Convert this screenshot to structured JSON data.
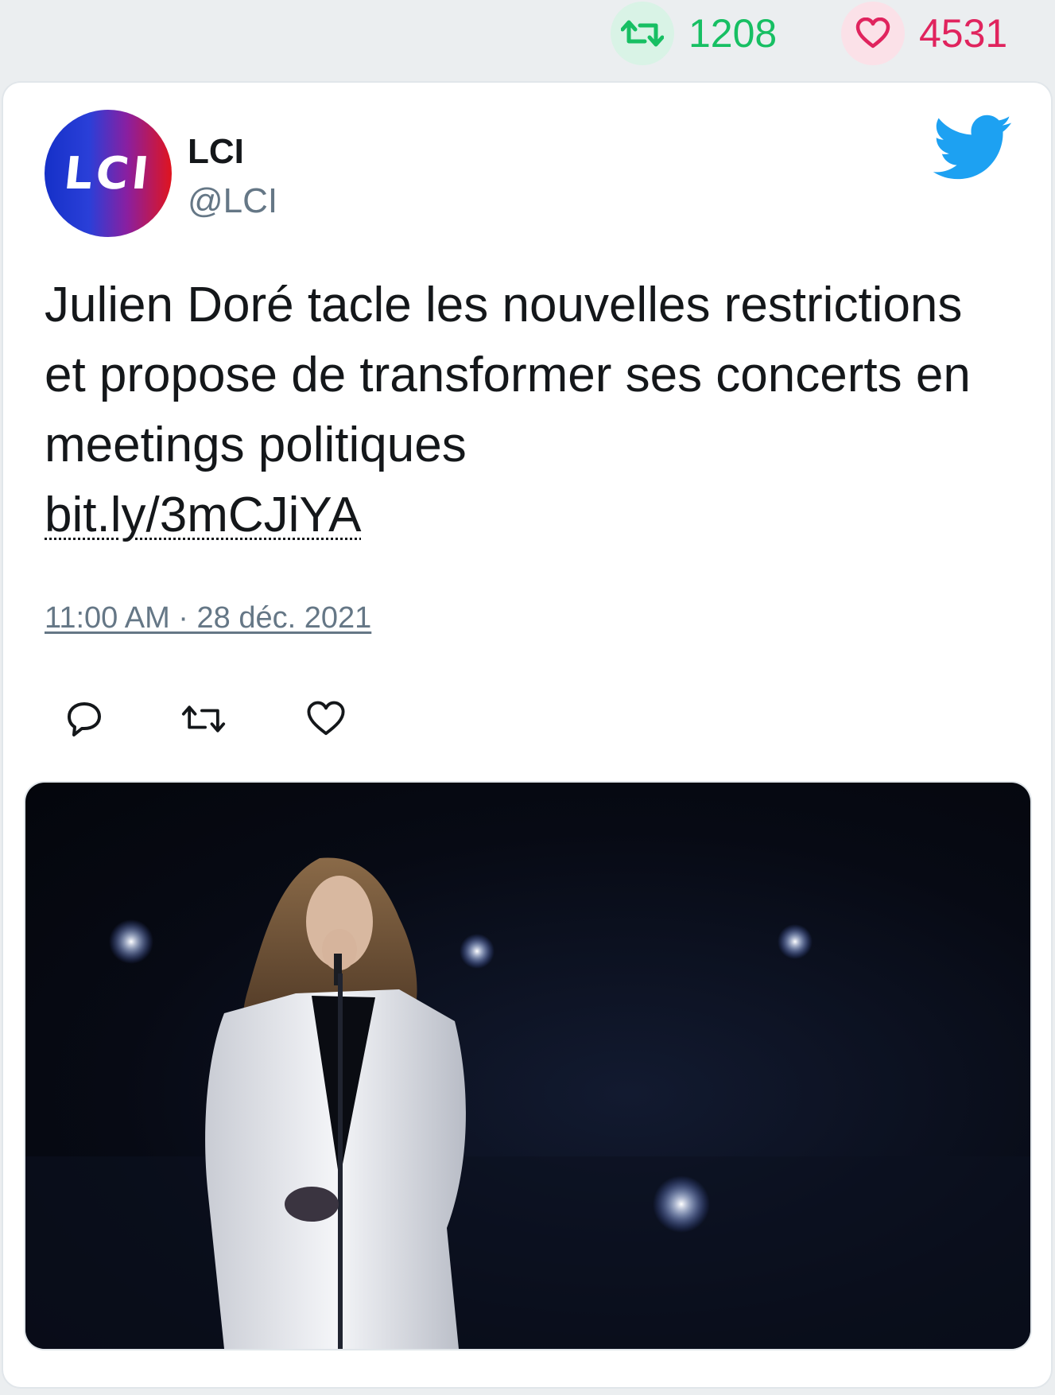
{
  "stats": {
    "retweets": "1208",
    "likes": "4531"
  },
  "author": {
    "name": "LCI",
    "handle": "@LCI",
    "avatar_text": "LCI"
  },
  "tweet": {
    "text": "Julien Doré tacle les nouvelles restrictions et propose de transformer ses concerts en meetings politiques",
    "link": "bit.ly/3mCJiYA",
    "timestamp": "11:00 AM · 28 déc. 2021"
  },
  "icons": {
    "stats_retweet": "retweet-icon",
    "stats_like": "heart-icon",
    "brand": "twitter-bird-icon",
    "reply": "reply-icon",
    "retweet": "retweet-icon",
    "like": "heart-icon"
  },
  "colors": {
    "retweet_green": "#17bf63",
    "like_red": "#e0245e",
    "twitter_blue": "#1da1f2",
    "text": "#14171a",
    "muted": "#657786"
  }
}
